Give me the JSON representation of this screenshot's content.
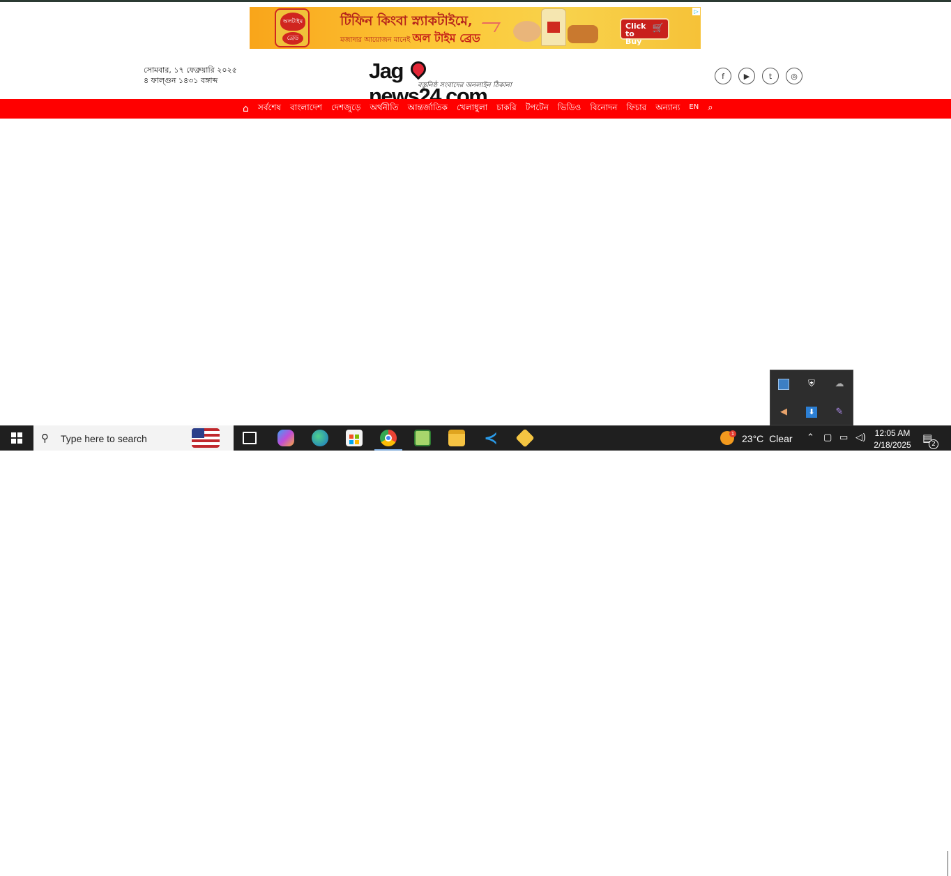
{
  "ad": {
    "logo_text": "অলটাইম",
    "logo_sub": "ব্রেড",
    "headline": "টিফিন কিংবা স্ন্যাকটাইমে,",
    "subline": "মজাদার আয়োজন মানেই",
    "brand": "অল টাইম ব্রেড",
    "cta_label": "Click to Buy",
    "cart_icon": "shopping-cart-icon",
    "choices_icon": "adchoices-icon"
  },
  "header": {
    "date_line1": "সোমবার, ১৭ ফেব্রুয়ারি ২০২৫",
    "date_line2": "৪ ফাল্গুন ১৪৩১ বঙ্গাব্দ",
    "logo_prefix": "Jag",
    "logo_suffix": "news24.com",
    "logo_tagline": "বস্তুনিষ্ঠ সংবাদের অনলাইন ঠিকানা",
    "socials": [
      {
        "name": "facebook-icon",
        "glyph": "f"
      },
      {
        "name": "youtube-icon",
        "glyph": "▶"
      },
      {
        "name": "twitter-icon",
        "glyph": "t"
      },
      {
        "name": "instagram-icon",
        "glyph": "◎"
      }
    ]
  },
  "nav": {
    "home_icon": "⌂",
    "items": [
      "সর্বশেষ",
      "বাংলাদেশ",
      "দেশজুড়ে",
      "অর্থনীতি",
      "আন্তর্জাতিক",
      "খেলাধুলা",
      "চাকরি",
      "টপটেন",
      "ভিডিও",
      "বিনোদন",
      "ফিচার",
      "অন্যান্য"
    ],
    "lang": "EN",
    "search_icon": "⌕"
  },
  "tray": {
    "icons": [
      "network-adapter-icon",
      "security-shield-icon",
      "cloud-offline-icon",
      "speaker-icon",
      "download-icon",
      "pen-icon"
    ]
  },
  "taskbar": {
    "search_placeholder": "Type here to search",
    "apps": [
      "task-view",
      "copilot",
      "edge",
      "microsoft-store",
      "chrome",
      "notepad-plus",
      "file-explorer",
      "vscode",
      "git-app"
    ],
    "weather_temp": "23°C",
    "weather_desc": "Clear",
    "weather_badge": "1",
    "time": "12:05 AM",
    "date": "2/18/2025",
    "notification_count": "2"
  }
}
